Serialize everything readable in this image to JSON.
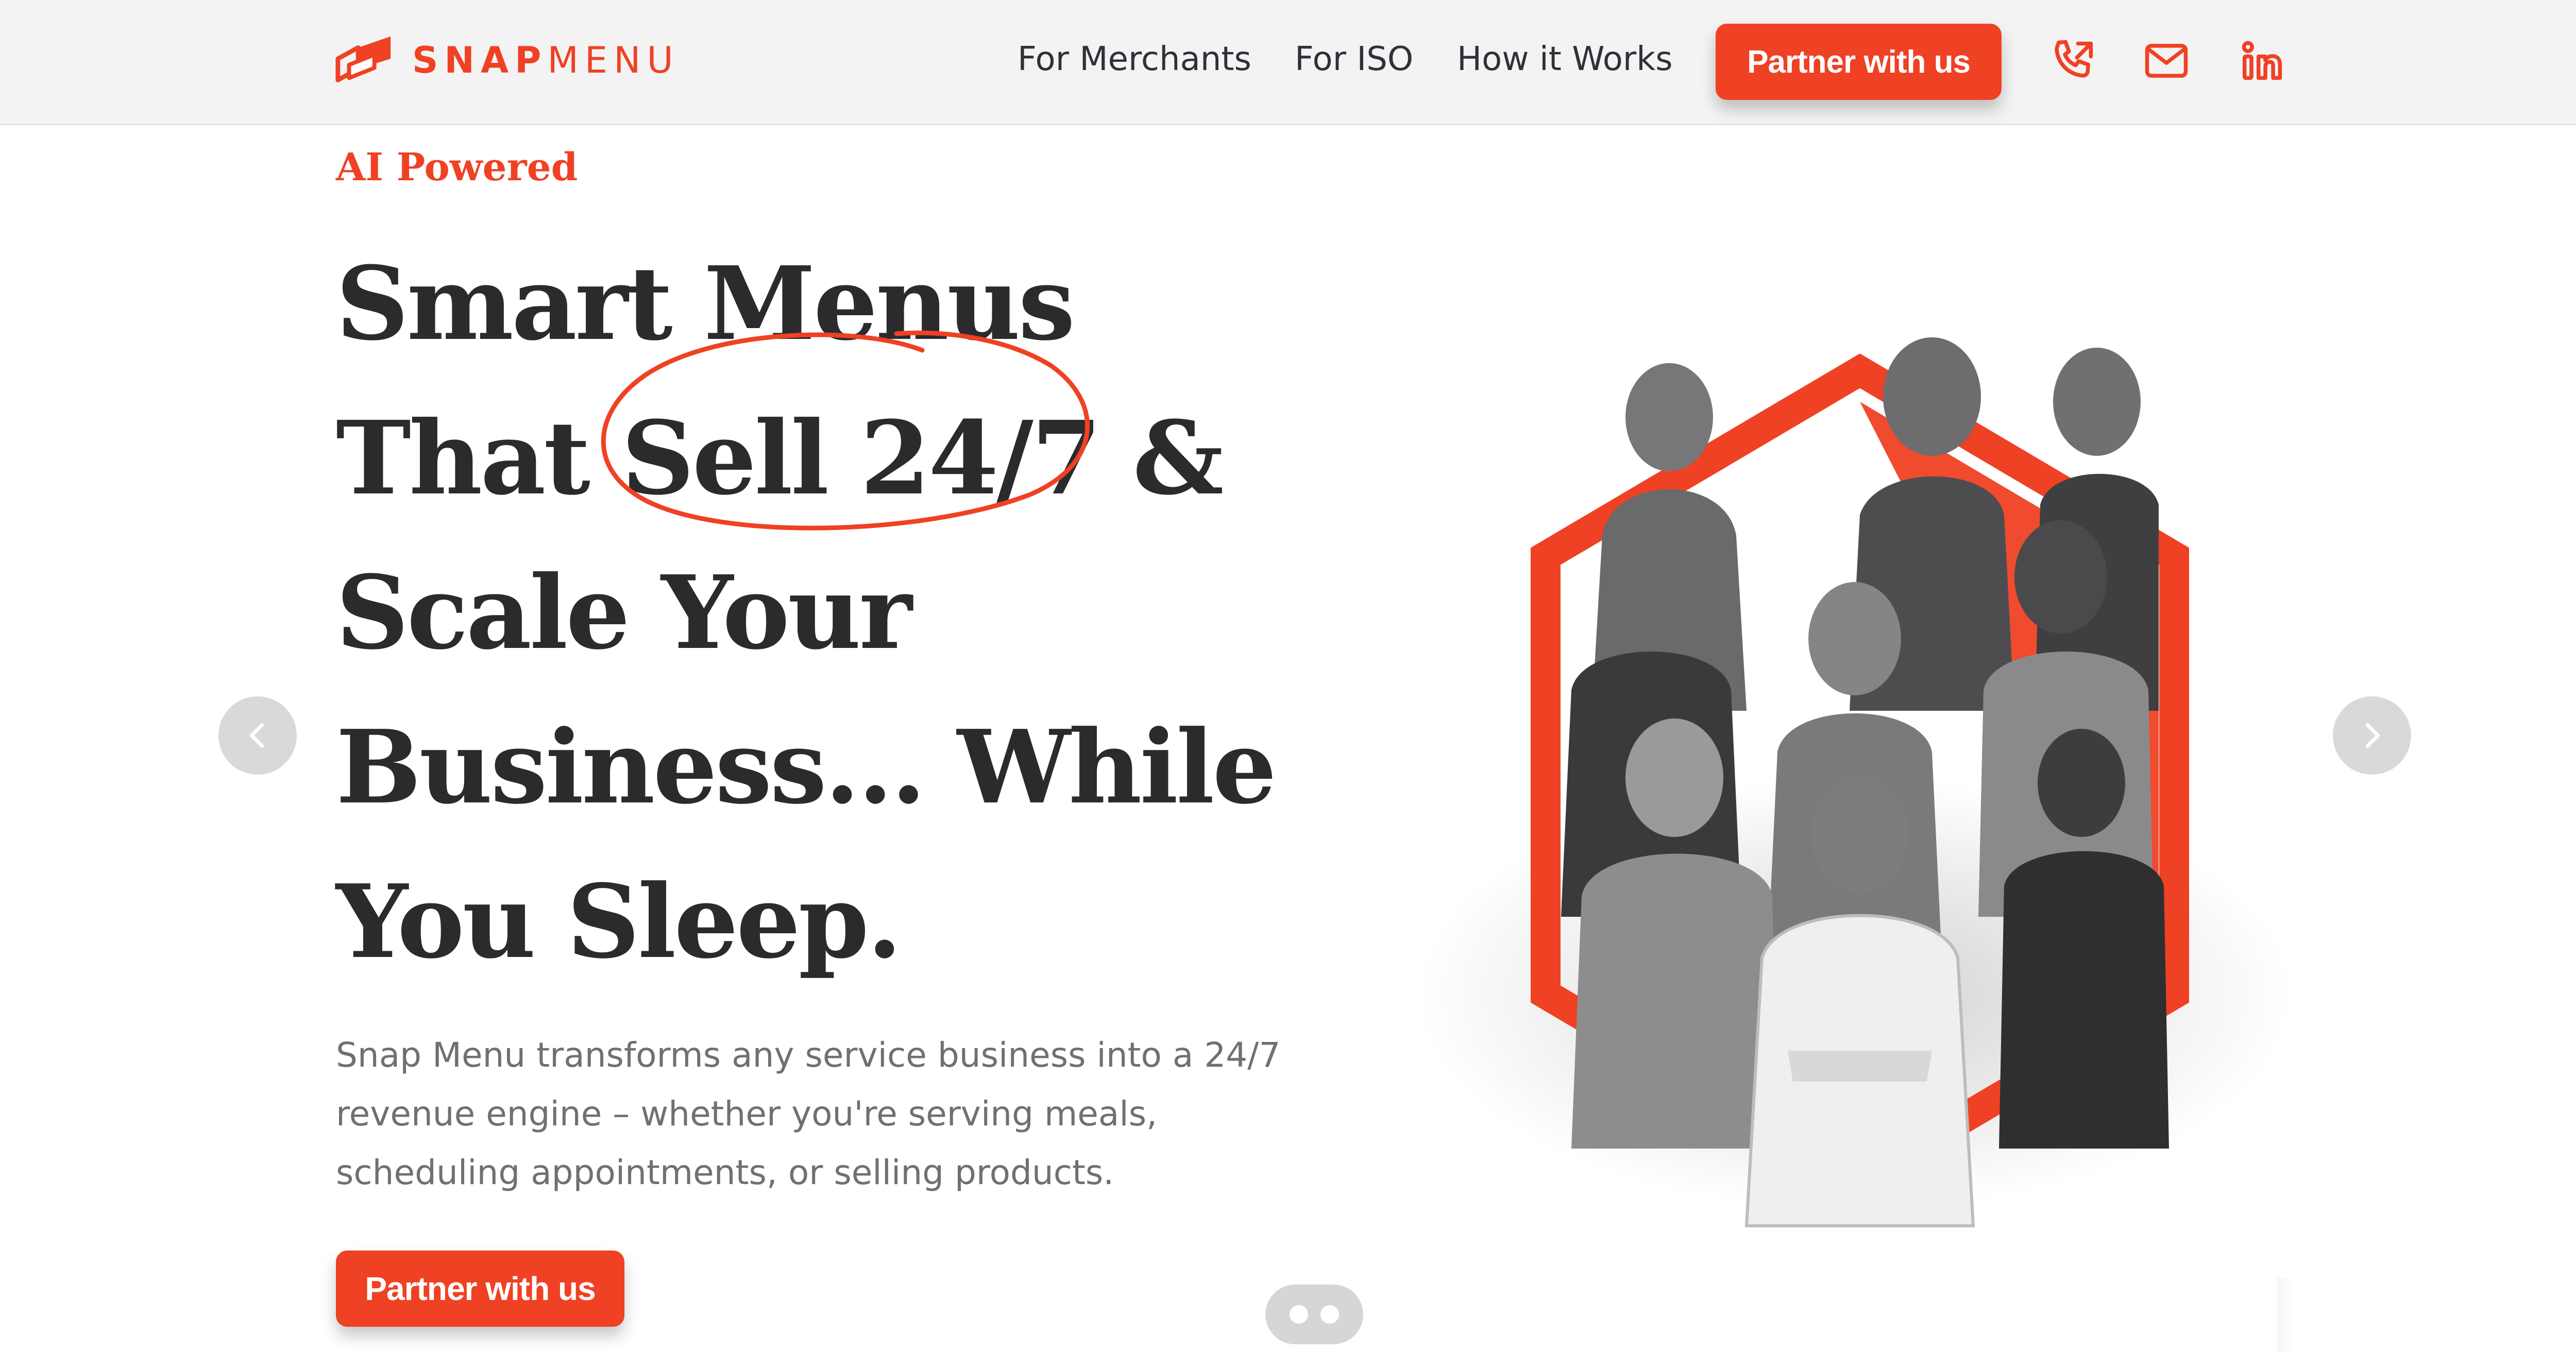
{
  "brand": {
    "name_bold": "SNAP",
    "name_light": "MENU",
    "accent": "#ef4123",
    "logo_icon": "snapmenu-logo-icon"
  },
  "nav": {
    "items": [
      {
        "label": "For Merchants"
      },
      {
        "label": "For ISO"
      },
      {
        "label": "How it Works"
      }
    ],
    "cta": "Partner with us",
    "icons": [
      "phone-icon",
      "mail-icon",
      "linkedin-icon"
    ]
  },
  "hero": {
    "eyebrow": "AI Powered",
    "headline_lines": [
      "Smart Menus",
      "That Sell 24/7 &",
      "Scale Your",
      "Business... While",
      "You Sleep."
    ],
    "body": "Snap Menu transforms any service business into a 24/7 revenue engine – whether you're serving meals, scheduling appointments, or selling products.",
    "cta": "Partner with us"
  },
  "carousel": {
    "prev_icon": "chevron-left-icon",
    "next_icon": "chevron-right-icon",
    "slide_count": 2
  },
  "colors": {
    "accent": "#ef4123",
    "heading": "#2b2b2e",
    "body_text": "#6f6f74",
    "header_bg": "#f4f3f4"
  }
}
